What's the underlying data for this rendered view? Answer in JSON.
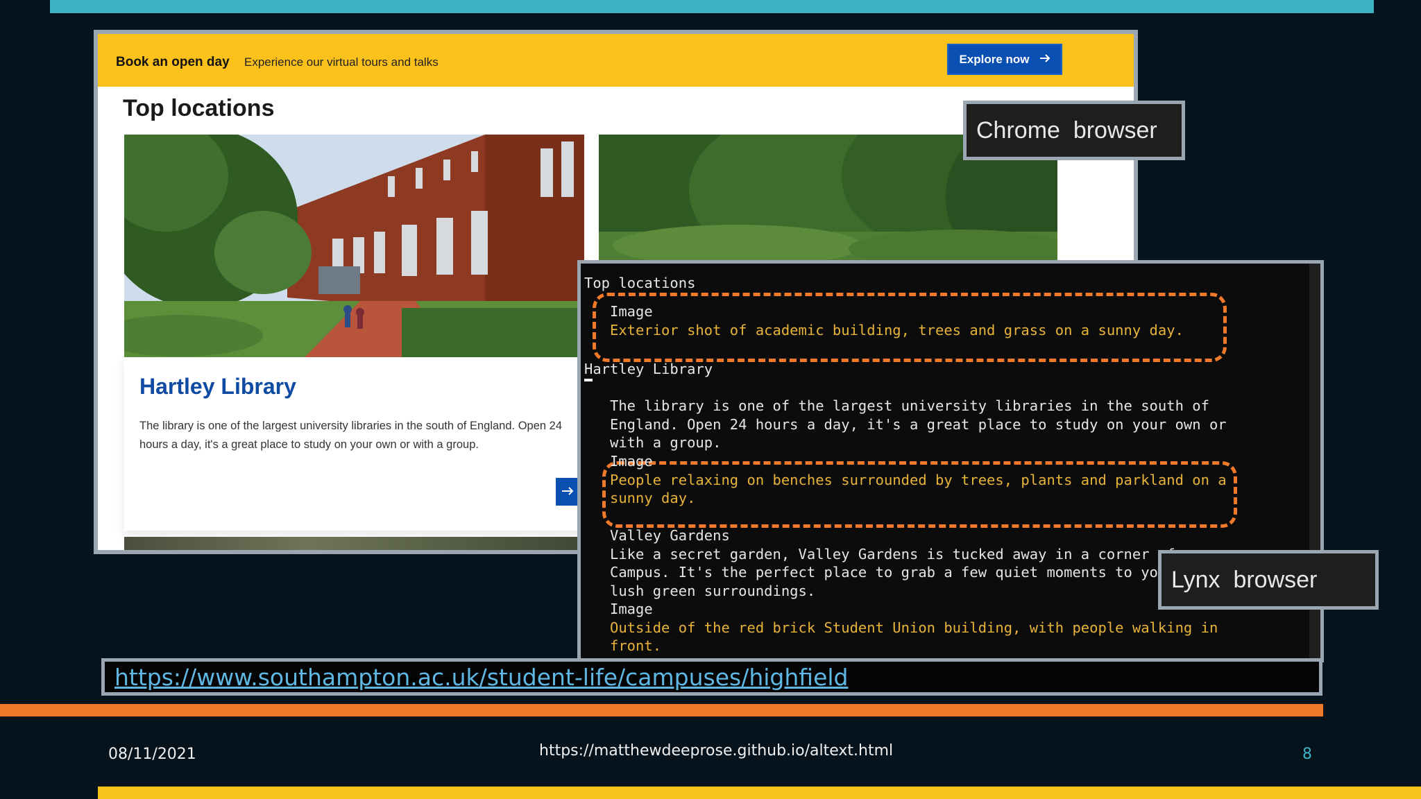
{
  "chrome": {
    "banner_title": "Book an open day",
    "banner_text": "Experience our virtual tours and talks",
    "explore_label": "Explore now",
    "explore_icon": "arrow-right-icon",
    "heading": "Top locations",
    "card": {
      "title": "Hartley Library",
      "description": "The library is one of the largest university libraries in the south of England. Open 24 hours a day, it's a great place to study on your own or with a group.",
      "arrow_icon": "arrow-right-icon"
    }
  },
  "labels": {
    "chrome": "Chrome  browser",
    "lynx": "Lynx  browser"
  },
  "lynx": {
    "lines": [
      "Top locations",
      "Image",
      "Exterior shot of academic building, trees and grass on a sunny day.",
      "Hartley Library",
      "The library is one of the largest university libraries in the south of",
      "England. Open 24 hours a day, it's a great place to study on your own or",
      "with a group.",
      "Image",
      "People relaxing on benches surrounded by trees, plants and parkland on a",
      "sunny day.",
      "Valley Gardens",
      "Like a secret garden, Valley Gardens is tucked away in a corner of",
      "Campus. It's the perfect place to grab a few quiet moments to yourself",
      "lush green surroundings.",
      "Image",
      "Outside of the red brick Student Union building, with people walking in",
      "front."
    ]
  },
  "url": "https://www.southampton.ac.uk/student-life/campuses/highfield",
  "footer": {
    "date": "08/11/2021",
    "source_url": "https://matthewdeeprose.github.io/altext.html",
    "page_number": "8"
  },
  "colors": {
    "accent_teal": "#3bb3c3",
    "accent_orange": "#f07a2a",
    "accent_yellow": "#f7c21a",
    "banner_yellow": "#fcc21b",
    "link_blue": "#0f4aa3",
    "alt_text_amber": "#e8b33a"
  }
}
